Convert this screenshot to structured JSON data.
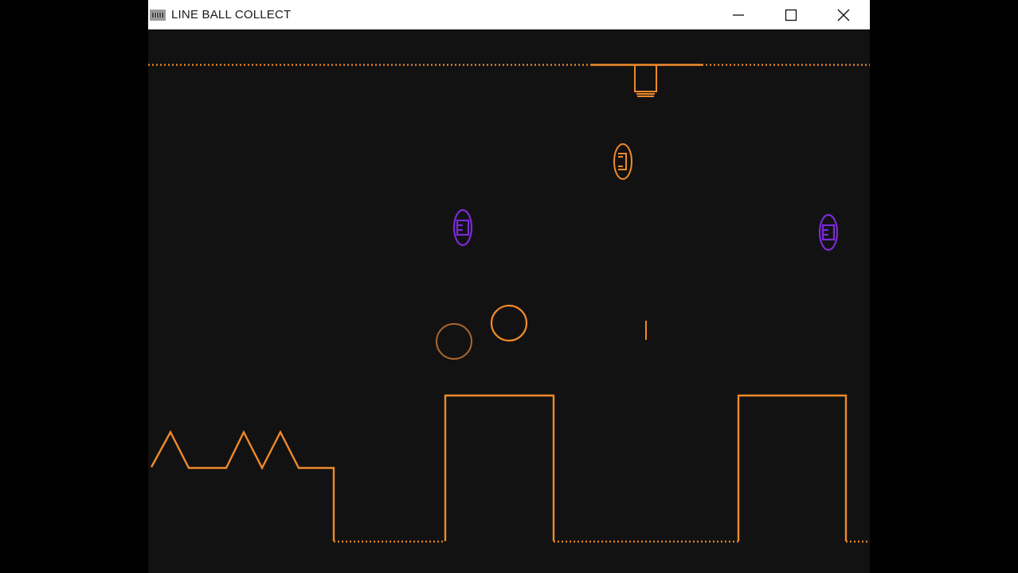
{
  "window": {
    "title": "LINE BALL COLLECT",
    "controls": [
      "minimize",
      "maximize",
      "close"
    ]
  },
  "colors": {
    "background": "#121212",
    "line": "#f08a2a",
    "collectible": "#7a2bd6"
  },
  "icons": {
    "app": "app-icon",
    "minimize": "minimize-icon",
    "maximize": "maximize-icon",
    "close": "close-icon"
  }
}
